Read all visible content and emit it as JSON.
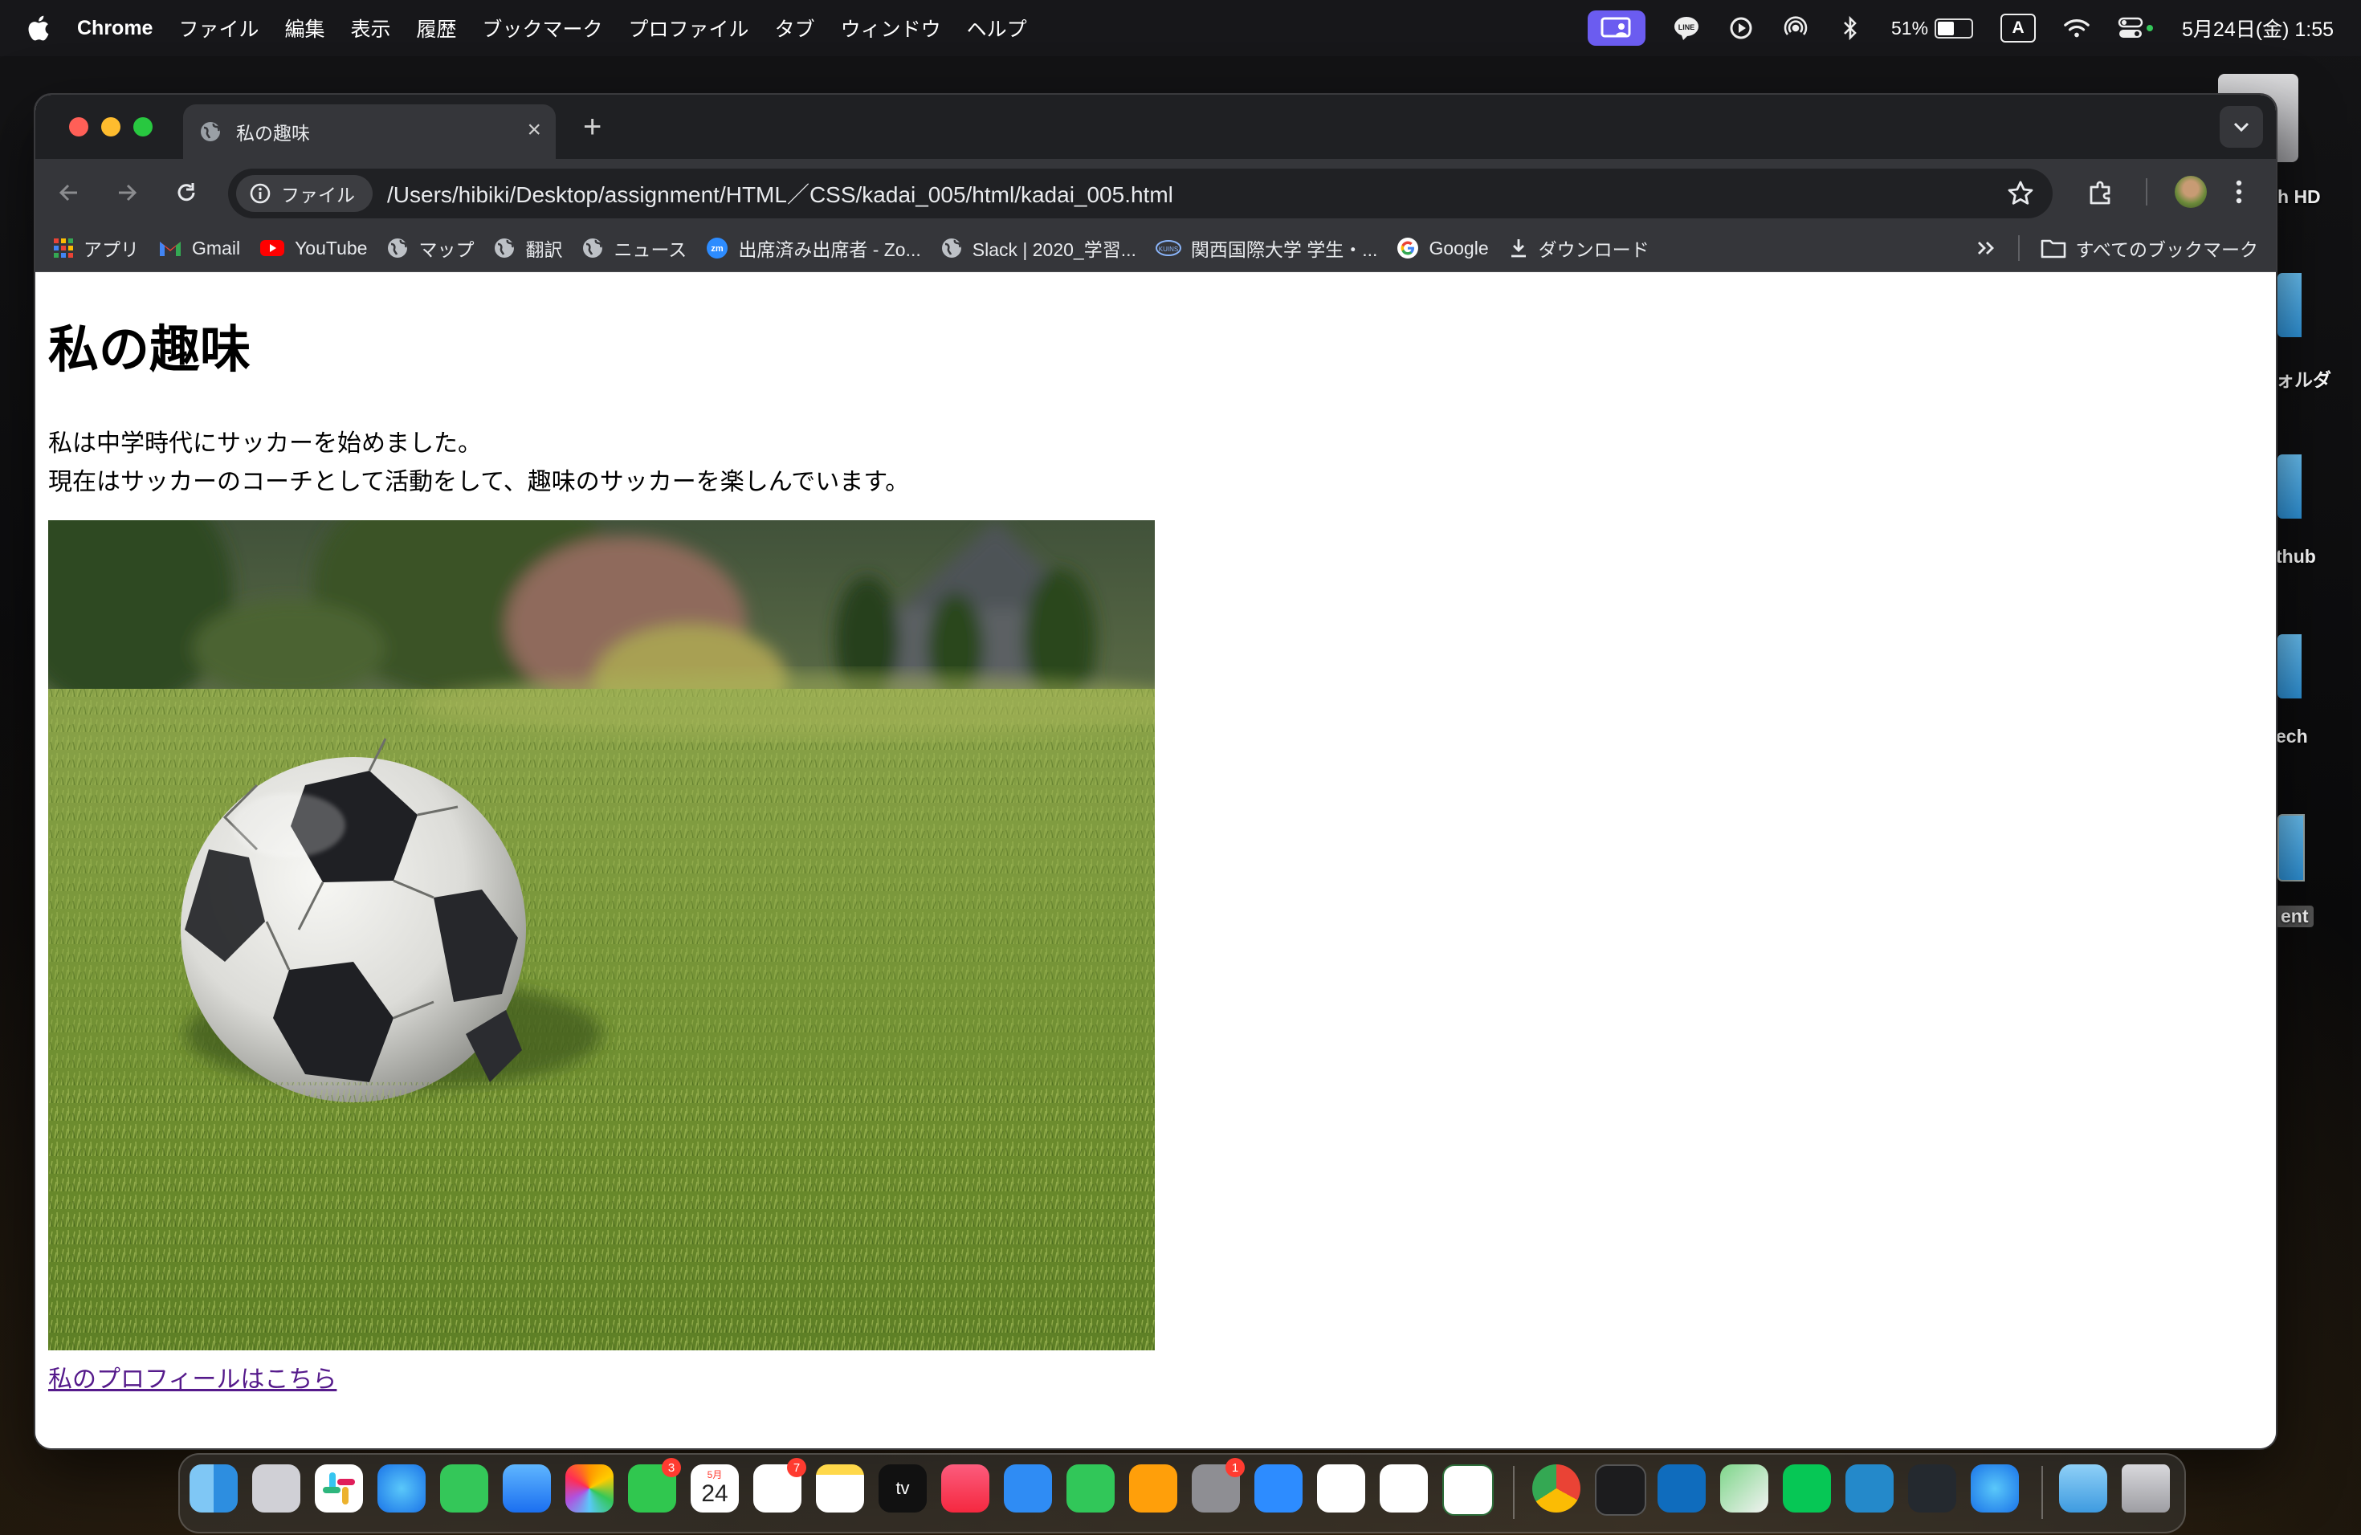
{
  "menubar": {
    "app_name": "Chrome",
    "menus": [
      "ファイル",
      "編集",
      "表示",
      "履歴",
      "ブックマーク",
      "プロファイル",
      "タブ",
      "ウィンドウ",
      "ヘルプ"
    ],
    "battery": "51%",
    "battery_level": 0.51,
    "input_mode": "A",
    "clock": "5月24日(金)  1:55",
    "status_icons": [
      "screen-share-icon",
      "line-icon",
      "play-icon",
      "airdrop-icon",
      "bluetooth-icon",
      "battery-icon",
      "input-source-icon",
      "wifi-icon",
      "control-center-icon"
    ]
  },
  "desktop": {
    "labels": [
      "h HD",
      "ォルダ",
      "thub",
      "ech",
      "ent"
    ]
  },
  "browser": {
    "tab_title": "私の趣味",
    "url_chip": "ファイル",
    "url": "/Users/hibiki/Desktop/assignment/HTML／CSS/kadai_005/html/kadai_005.html",
    "bookmarks": [
      {
        "label": "アプリ",
        "icon": "apps-grid-icon"
      },
      {
        "label": "Gmail",
        "icon": "gmail-icon"
      },
      {
        "label": "YouTube",
        "icon": "youtube-icon"
      },
      {
        "label": "マップ",
        "icon": "globe-icon"
      },
      {
        "label": "翻訳",
        "icon": "globe-icon"
      },
      {
        "label": "ニュース",
        "icon": "globe-icon"
      },
      {
        "label": "出席済み出席者 - Zo...",
        "icon": "zoom-icon"
      },
      {
        "label": "Slack | 2020_学習...",
        "icon": "globe-icon"
      },
      {
        "label": "関西国際大学 学生・...",
        "icon": "kuins-icon"
      },
      {
        "label": "Google",
        "icon": "google-icon"
      },
      {
        "label": "ダウンロード",
        "icon": "download-icon"
      }
    ],
    "all_bookmarks": "すべてのブックマーク"
  },
  "page": {
    "heading": "私の趣味",
    "line1": "私は中学時代にサッカーを始めました。",
    "line2": "現在はサッカーのコーチとして活動をして、趣味のサッカーを楽しんでいます。",
    "image_alt": "soccer ball on grass",
    "link": "私のプロフィールはこちら"
  },
  "dock": {
    "apps": [
      "Finder",
      "Launchpad",
      "Slack",
      "Safari",
      "Messages",
      "Mail",
      "Photos",
      "FaceTime",
      "Calendar",
      "Reminders",
      "Notes",
      "TV",
      "Music",
      "Keynote",
      "Numbers",
      "Pages",
      "System Settings",
      "Zoom",
      "Google Meet",
      "Scrivener",
      "W3Schools",
      "Chrome",
      "Terminal",
      "Outlook",
      "Maps",
      "LINE",
      "VS Code",
      "GitHub Desktop",
      "Safari",
      "Downloads",
      "Trash"
    ],
    "badges": {
      "facetime": "3",
      "reminders": "7",
      "settings": "1"
    },
    "calendar_month": "5月",
    "calendar_day": "24",
    "tv_label": "tv"
  },
  "colors": {
    "chrome_frame": "#1f2023",
    "chrome_toolbar": "#35363a",
    "omnibox": "#202124",
    "link_visited": "#551a8b",
    "screen_share": "#6b5cf0"
  }
}
